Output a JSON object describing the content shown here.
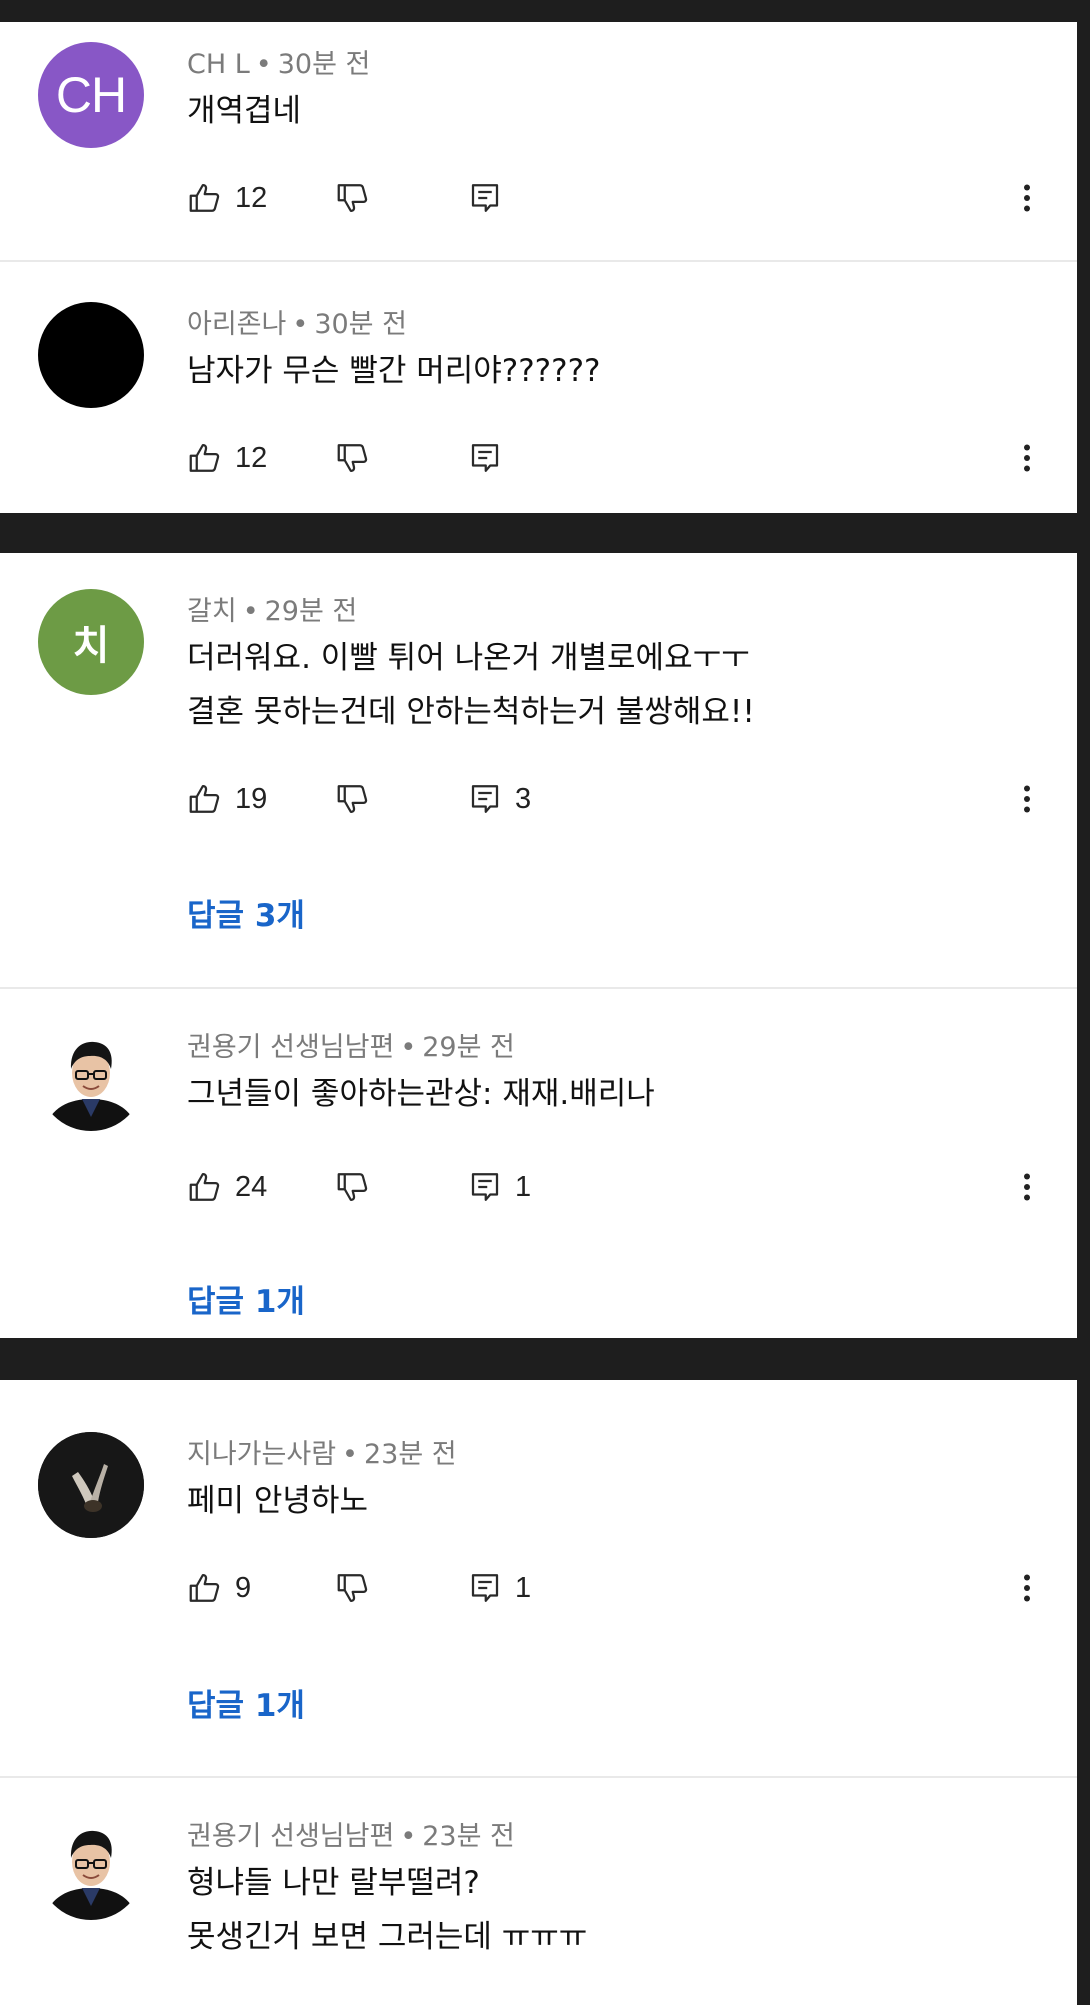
{
  "comments": [
    {
      "author": "CH L",
      "time": "30분 전",
      "avatar_text": "CH",
      "avatar_color": "#8857c6",
      "lines": [
        "개역겹네"
      ],
      "likes": "12",
      "replies_count": "",
      "replies_link": ""
    },
    {
      "author": "아리존나",
      "time": "30분 전",
      "avatar_text": "",
      "avatar_color": "#000000",
      "lines": [
        "남자가 무슨 빨간 머리야??????"
      ],
      "likes": "12",
      "replies_count": "",
      "replies_link": ""
    },
    {
      "author": "갈치",
      "time": "29분 전",
      "avatar_text": "치",
      "avatar_color": "#6d9b45",
      "lines": [
        "더러워요. 이빨 튀어 나온거 개별로에요ㅜㅜ",
        "결혼 못하는건데 안하는척하는거 불쌍해요!!"
      ],
      "likes": "19",
      "replies_count": "3",
      "replies_link": "답글 3개"
    },
    {
      "author": "권용기 선생님남편",
      "time": "29분 전",
      "avatar_text": "",
      "avatar_color": "#ffffff",
      "lines": [
        "그년들이 좋아하는관상: 재재.배리나"
      ],
      "likes": "24",
      "replies_count": "1",
      "replies_link": "답글 1개"
    },
    {
      "author": "지나가는사람",
      "time": "23분 전",
      "avatar_text": "",
      "avatar_color": "#1a1a1a",
      "lines": [
        "페미 안녕하노"
      ],
      "likes": "9",
      "replies_count": "1",
      "replies_link": "답글 1개"
    },
    {
      "author": "권용기 선생님남편",
      "time": "23분 전",
      "avatar_text": "",
      "avatar_color": "#ffffff",
      "lines": [
        "형냐들 나만 랄부떨려?",
        "못생긴거 보면 그러는데 ㅠㅠㅠ"
      ],
      "likes": "",
      "replies_count": "",
      "replies_link": ""
    }
  ],
  "icons": {
    "like": "thumbs-up-icon",
    "dislike": "thumbs-down-icon",
    "reply": "reply-icon",
    "more": "more-vert-icon",
    "avatar_person": "person-glasses-avatar",
    "avatar_hands": "hands-avatar"
  },
  "colors": {
    "reply_link": "#1965c9",
    "meta_text": "#7b7b7b",
    "separator_band": "#1e1e1e"
  }
}
